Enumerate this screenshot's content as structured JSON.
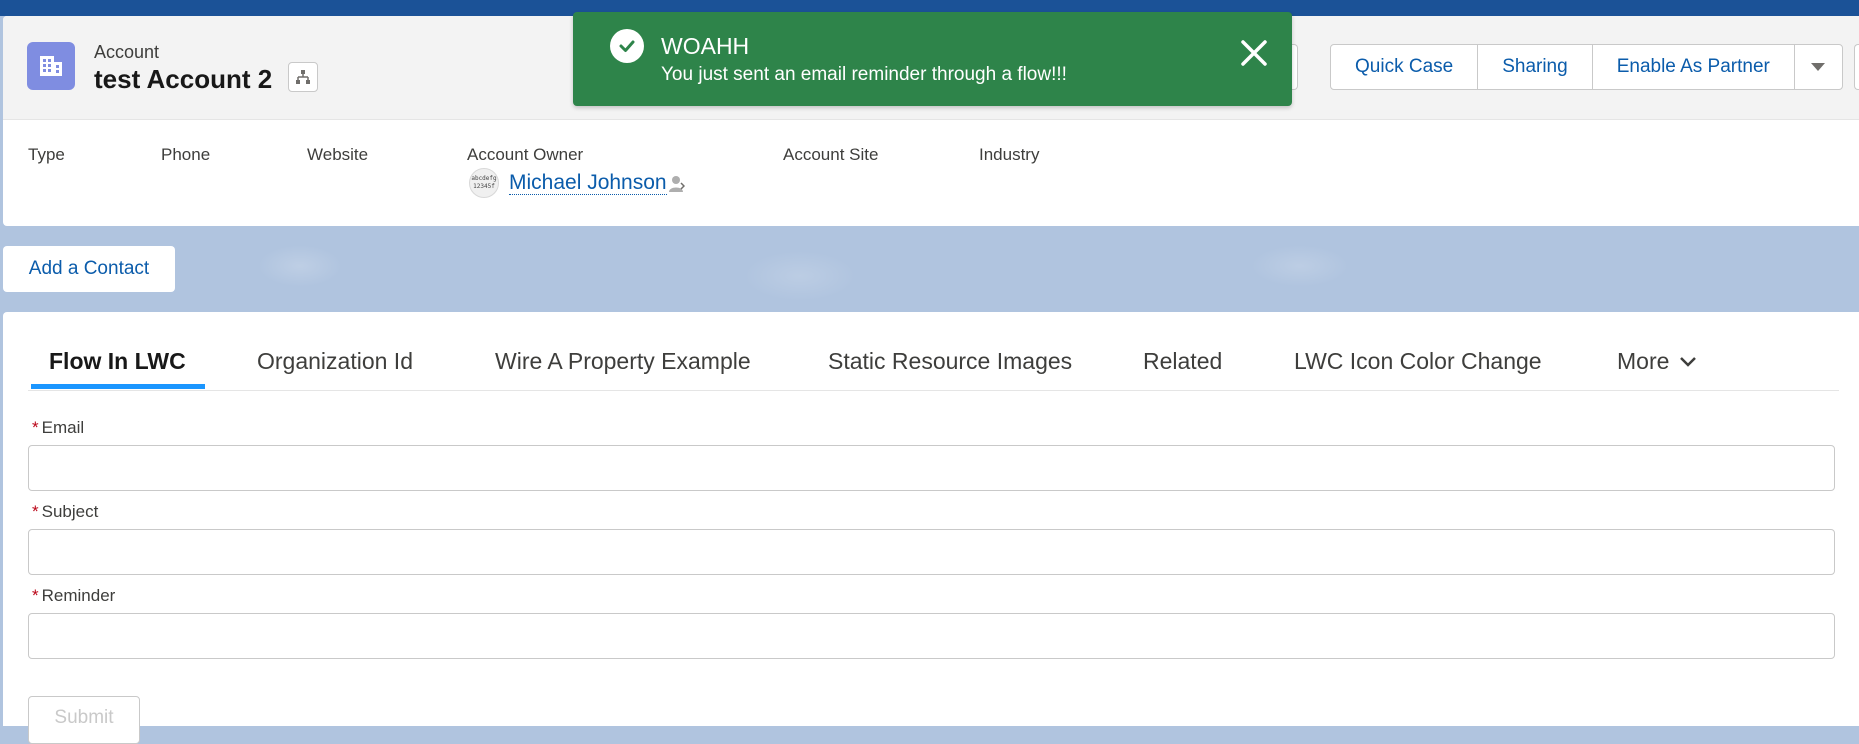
{
  "header": {
    "object_label": "Account",
    "record_title": "test Account 2",
    "actions": [
      "Quick Case",
      "Sharing",
      "Enable As Partner"
    ],
    "fields": [
      {
        "label": "Type"
      },
      {
        "label": "Phone"
      },
      {
        "label": "Website"
      },
      {
        "label": "Account Owner"
      },
      {
        "label": "Account Site"
      },
      {
        "label": "Industry"
      }
    ],
    "owner_name": "Michael Johnson",
    "owner_avatar_text": [
      "abcdefg",
      "12345f"
    ]
  },
  "toast": {
    "title": "WOAHH",
    "message": "You just sent an email reminder through a flow!!!",
    "color": "#2e844a"
  },
  "add_contact_label": "Add a Contact",
  "tabs": [
    {
      "label": "Flow In LWC",
      "active": true
    },
    {
      "label": "Organization Id"
    },
    {
      "label": "Wire A Property Example"
    },
    {
      "label": "Static Resource Images"
    },
    {
      "label": "Related"
    },
    {
      "label": "LWC Icon Color Change"
    },
    {
      "label": "More"
    }
  ],
  "form": {
    "required_marker": "*",
    "email_label": "Email",
    "subject_label": "Subject",
    "reminder_label": "Reminder",
    "email_value": "",
    "subject_value": "",
    "reminder_value": "",
    "submit_label": "Submit"
  },
  "colors": {
    "brand_link": "#0b5cab",
    "object_icon": "#7f8de1",
    "active_tab_underline": "#1b96ff",
    "required": "#ba0517"
  }
}
